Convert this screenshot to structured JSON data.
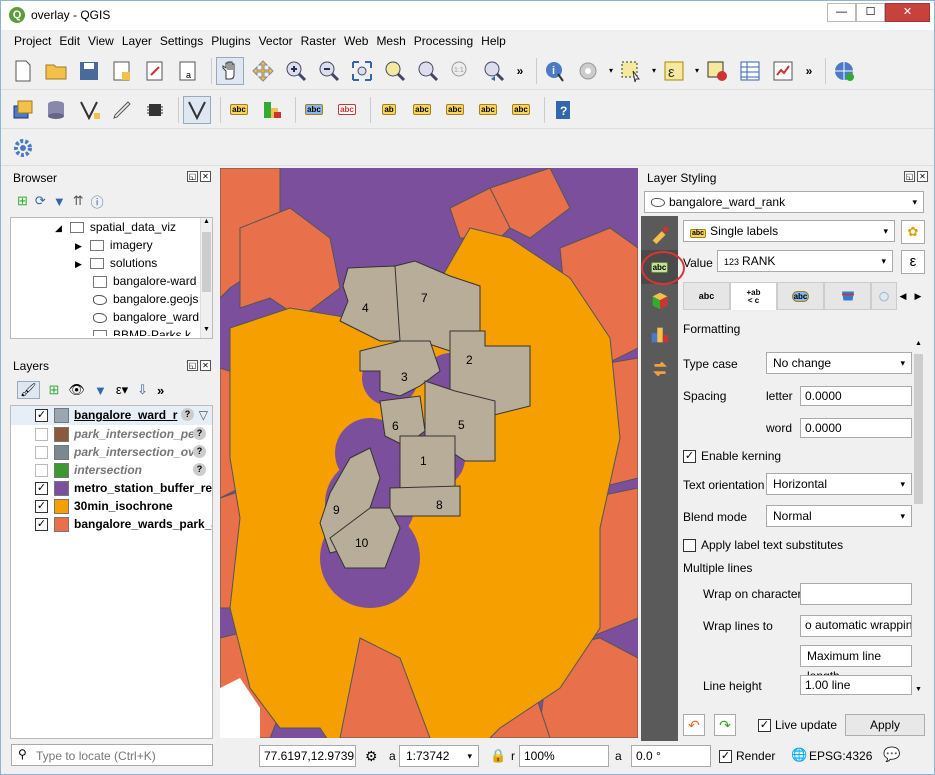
{
  "window": {
    "title": "overlay - QGIS",
    "min": "—",
    "max": "☐",
    "close": "✕"
  },
  "menu": [
    "Project",
    "Edit",
    "View",
    "Layer",
    "Settings",
    "Plugins",
    "Vector",
    "Raster",
    "Web",
    "Mesh",
    "Processing",
    "Help"
  ],
  "browser": {
    "title": "Browser",
    "items": [
      {
        "label": "spatial_data_viz",
        "icon": "folder-icon"
      },
      {
        "label": "imagery",
        "icon": "folder-icon"
      },
      {
        "label": "solutions",
        "icon": "folder-icon"
      },
      {
        "label": "bangalore-ward",
        "icon": "file-icon"
      },
      {
        "label": "bangalore.geojs",
        "icon": "polygon-icon"
      },
      {
        "label": "bangalore_ward",
        "icon": "polygon-icon"
      },
      {
        "label": "BBMP-Parks.k",
        "icon": "file-icon"
      }
    ]
  },
  "layers": {
    "title": "Layers",
    "items": [
      {
        "label": "bangalore_ward_r",
        "color": "#9aa6b2",
        "checked": "✓",
        "style": "bold-underline"
      },
      {
        "label": "park_intersection_pe",
        "color": "#8b5a3c",
        "checked": "",
        "style": "italic"
      },
      {
        "label": "park_intersection_ov",
        "color": "#7a8890",
        "checked": "",
        "style": "italic"
      },
      {
        "label": "intersection",
        "color": "#3a9a2e",
        "checked": "",
        "style": "italic"
      },
      {
        "label": "metro_station_buffer_re",
        "color": "#7b4f9c",
        "checked": "✓",
        "style": "bold"
      },
      {
        "label": "30min_isochrone",
        "color": "#f5a000",
        "checked": "✓",
        "style": "bold"
      },
      {
        "label": "bangalore_wards_park_a",
        "color": "#e8704a",
        "checked": "✓",
        "style": "bold"
      }
    ]
  },
  "map": {
    "ward_labels": [
      "7",
      "4",
      "2",
      "3",
      "6",
      "5",
      "1",
      "9",
      "8",
      "10"
    ]
  },
  "styling": {
    "title": "Layer Styling",
    "layer": "bangalore_ward_rank",
    "renderer": "Single labels",
    "value_label": "Value",
    "value_prefix": "123",
    "value": "RANK",
    "tabs": [
      "abc",
      "+ab\n< c",
      "abc",
      "",
      ""
    ],
    "section": "Formatting",
    "type_case_label": "Type case",
    "type_case": "No change",
    "spacing_label": "Spacing",
    "letter_label": "letter",
    "letter": "0.0000",
    "word_label": "word",
    "word": "0.0000",
    "kerning_label": "Enable kerning",
    "kerning_checked": "✓",
    "orientation_label": "Text orientation",
    "orientation": "Horizontal",
    "blend_label": "Blend mode",
    "blend": "Normal",
    "substitutes_label": "Apply label text substitutes",
    "multiple_lines_label": "Multiple lines",
    "wrap_char_label": "Wrap on character",
    "wrap_char": "",
    "wrap_to_label": "Wrap lines to",
    "wrap_to": "o automatic wrapping",
    "max_line": "Maximum line length",
    "line_height_label": "Line height",
    "line_height": "1.00 line",
    "live_update_label": "Live update",
    "live_checked": "✓",
    "apply": "Apply"
  },
  "status": {
    "locate_placeholder": "Type to locate (Ctrl+K)",
    "coord": "77.6197,12.9739",
    "scale_prefix": "a",
    "scale": "1:73742",
    "mag_prefix": "r",
    "magnifier": "100%",
    "rot_prefix": "a",
    "rotation": "0.0 °",
    "render_label": "Render",
    "render_checked": "✓",
    "crs": "EPSG:4326"
  }
}
